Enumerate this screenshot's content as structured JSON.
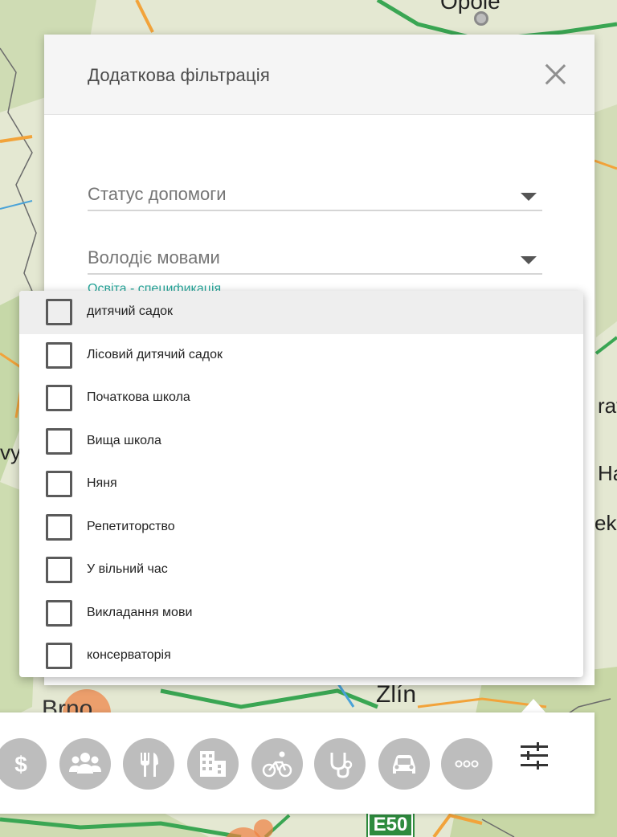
{
  "dialog": {
    "title": "Додаткова фільтрація",
    "fields": {
      "status": "Статус допомоги",
      "languages": "Володіє мовами",
      "education_label": "Освіта - спецификація"
    }
  },
  "dropdown": {
    "options": [
      "дитячий садок",
      "Лісовий дитячий садок",
      "Початкова школа",
      "Вища школа",
      "Няня",
      "Репетиторство",
      "У вільний час",
      "Викладання мови",
      "консерваторія"
    ]
  },
  "map": {
    "labels": {
      "opole": "Opole",
      "zlin": "Zlín",
      "brno": "Brno",
      "rav": "rav",
      "h": "Ha",
      "ek": "ek-",
      "y": "vy"
    },
    "road_shield": "E50"
  },
  "toolbar": {
    "categories": [
      "money-icon",
      "group-icon",
      "restaurant-icon",
      "building-icon",
      "bicycle-icon",
      "stethoscope-icon",
      "car-icon",
      "more-icon"
    ],
    "filter_icon": "tune-icon"
  },
  "colors": {
    "accent_teal": "#26a69a",
    "icon_gray": "#bdbdbd",
    "map_green": "#2e8b3e"
  }
}
